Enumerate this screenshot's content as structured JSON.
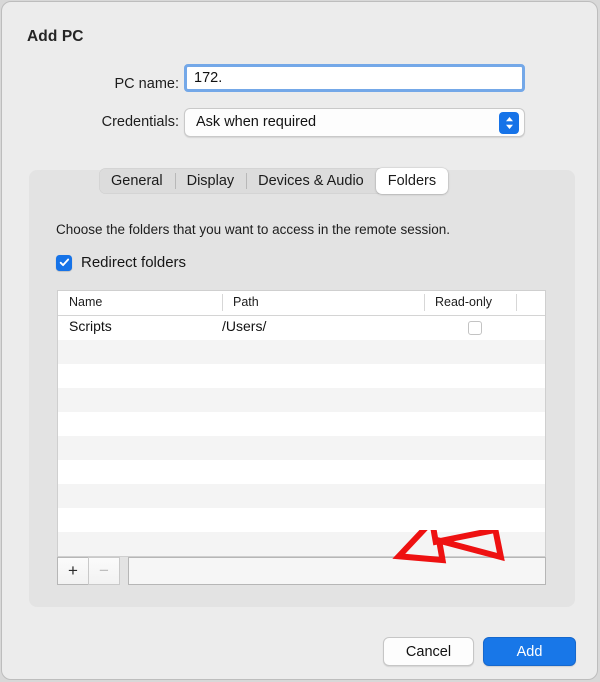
{
  "dialog": {
    "title": "Add PC"
  },
  "form": {
    "pc_name": {
      "label": "PC name:",
      "value": "172.",
      "placeholder": "",
      "focused": true
    },
    "credentials": {
      "label": "Credentials:",
      "selected": "Ask when required",
      "options": [
        "Ask when required"
      ],
      "stepper_icon": "up-down-chevrons-icon"
    }
  },
  "tabs": [
    {
      "label": "General",
      "selected": false
    },
    {
      "label": "Display",
      "selected": false
    },
    {
      "label": "Devices & Audio",
      "selected": false
    },
    {
      "label": "Folders",
      "selected": true
    }
  ],
  "folders_pane": {
    "description": "Choose the folders that you want to access in the remote session.",
    "redirect_checkbox": {
      "label": "Redirect folders",
      "checked": true,
      "icon": "checkmark-icon"
    },
    "table": {
      "columns": [
        "Name",
        "Path",
        "Read-only"
      ],
      "rows": [
        {
          "name": "Scripts",
          "path": "/Users/",
          "read_only": false
        }
      ],
      "empty_row_count": 9
    },
    "toolbar": {
      "add_label": "+",
      "remove_label": "−",
      "remove_enabled": false,
      "field_value": ""
    }
  },
  "footer": {
    "cancel_label": "Cancel",
    "add_label": "Add"
  },
  "annotation": {
    "shape": "arrow-outline",
    "color": "#ee1111",
    "points_to": "Add"
  },
  "colors": {
    "accent": "#1877e8",
    "focus_ring": "#74a8e8",
    "window_bg": "#ececec",
    "panel_bg": "#e3e3e3",
    "annotation": "#ee1111"
  }
}
